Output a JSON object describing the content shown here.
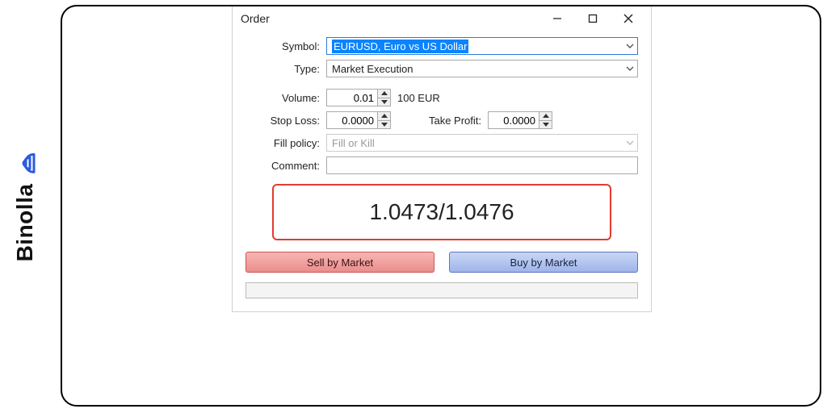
{
  "brand": {
    "name": "Binolla"
  },
  "window": {
    "title": "Order"
  },
  "labels": {
    "symbol": "Symbol:",
    "type": "Type:",
    "volume": "Volume:",
    "stop_loss": "Stop Loss:",
    "take_profit": "Take Profit:",
    "fill_policy": "Fill policy:",
    "comment": "Comment:"
  },
  "fields": {
    "symbol": "EURUSD, Euro vs US Dollar",
    "type": "Market Execution",
    "volume": "0.01",
    "volume_hint": "100 EUR",
    "stop_loss": "0.0000",
    "take_profit": "0.0000",
    "fill_policy": "Fill or Kill",
    "comment": ""
  },
  "quote": {
    "bid": "1.0473",
    "sep": " / ",
    "ask": "1.0476"
  },
  "buttons": {
    "sell": "Sell by Market",
    "buy": "Buy by Market"
  },
  "colors": {
    "accent_red": "#e23b2e",
    "accent_blue": "#2A7DE1",
    "brand_blue": "#2A5BE2"
  }
}
